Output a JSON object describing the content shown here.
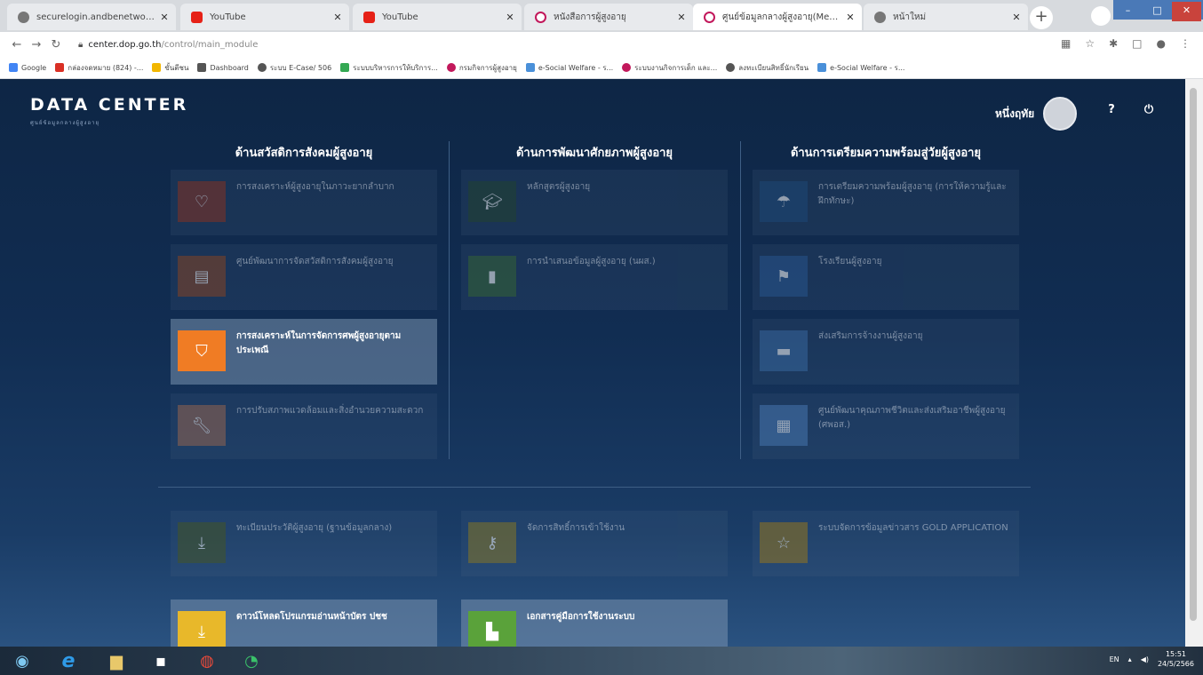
{
  "browser": {
    "tabs": [
      {
        "title": "securelogin.andbenetworks.co",
        "icon": "globe",
        "active": false
      },
      {
        "title": "YouTube",
        "icon": "youtube",
        "active": false
      },
      {
        "title": "YouTube",
        "icon": "youtube",
        "active": false
      },
      {
        "title": "หนังสือการผู้สูงอายุ",
        "icon": "dop-logo",
        "active": false
      },
      {
        "title": "ศูนย์ข้อมูลกลางผู้สูงอายุ(Menu)",
        "icon": "dop-logo",
        "active": true
      },
      {
        "title": "หน้าใหม่",
        "icon": "globe",
        "active": false
      }
    ],
    "url_host": "center.dop.go.th",
    "url_path": "/control/main_module",
    "bookmarks": [
      {
        "label": "Google",
        "color": "#4285f4"
      },
      {
        "label": "กล่องจดหมาย (824) -...",
        "color": "#d93025"
      },
      {
        "label": "ขั้นตีชน",
        "color": "#f2b600"
      },
      {
        "label": "Dashboard",
        "color": "#555555"
      },
      {
        "label": "ระบบ E-Case/ 506",
        "color": "#555555"
      },
      {
        "label": "ระบบบริหารการให้บริการ...",
        "color": "#34a853"
      },
      {
        "label": "กรมกิจการผู้สูงอายุ",
        "color": "#c2185b"
      },
      {
        "label": "e-Social Welfare - ร...",
        "color": "#4a90d9"
      },
      {
        "label": "ระบบงานกิจการเด็ก และ...",
        "color": "#c2185b"
      },
      {
        "label": "ลงทะเบียนสิทธิ์นักเรียน",
        "color": "#555555"
      },
      {
        "label": "e-Social Welfare - ร...",
        "color": "#4a90d9"
      }
    ]
  },
  "header": {
    "brand": "DATA CENTER",
    "brand_sub": "ศูนย์ข้อมูลกลางผู้สูงอายุ",
    "user_name": "หนึ่งฤทัย"
  },
  "columns": [
    {
      "title": "ด้านสวัสดิการสังคมผู้สูงอายุ"
    },
    {
      "title": "ด้านการพัฒนาศักยภาพผู้สูงอายุ"
    },
    {
      "title": "ด้านการเตรียมความพร้อมสู่วัยผู้สูงอายุ"
    }
  ],
  "cards": {
    "welfare": [
      {
        "label": "การสงเคราะห์ผู้สูงอายุในภาวะยากลำบาก",
        "icon": "heart-icon",
        "color": "#8b3a2b"
      },
      {
        "label": "ศูนย์พัฒนาการจัดสวัสดิการสังคมผู้สูงอายุ",
        "icon": "building-icon",
        "color": "#8b4a2b"
      },
      {
        "label": "การสงเคราะห์ในการจัดการศพผู้สูงอายุตามประเพณี",
        "icon": "bookmark-icon",
        "color": "#f07c24"
      },
      {
        "label": "การปรับสภาพแวดล้อมและสิ่งอำนวยความสะดวก",
        "icon": "wrench-icon",
        "color": "#9a6a55"
      }
    ],
    "development": [
      {
        "label": "หลักสูตรผู้สูงอายุ",
        "icon": "graduation-cap-icon",
        "color": "#2a4a38"
      },
      {
        "label": "การนำเสนอข้อมูลผู้สูงอายุ (นผส.)",
        "icon": "book-icon",
        "color": "#3c6a3c"
      }
    ],
    "preparation": [
      {
        "label": "การเตรียมความพร้อมผู้สูงอายุ (การให้ความรู้และฝึกทักษะ)",
        "icon": "umbrella-icon",
        "color": "#25507e"
      },
      {
        "label": "โรงเรียนผู้สูงอายุ",
        "icon": "flag-icon",
        "color": "#2f5c94"
      },
      {
        "label": "ส่งเสริมการจ้างงานผู้สูงอายุ",
        "icon": "briefcase-icon",
        "color": "#3f6ea4"
      },
      {
        "label": "ศูนย์พัฒนาคุณภาพชีวิตและส่งเสริมอาชีพผู้สูงอายุ (ศพอส.)",
        "icon": "building-icon",
        "color": "#4e7cb4"
      }
    ],
    "bottom": [
      {
        "label": "ทะเบียนประวัติผู้สูงอายุ (ฐานข้อมูลกลาง)",
        "icon": "download-icon",
        "color": "#4a5a2a"
      },
      {
        "label": "จัดการสิทธิ์การเข้าใช้งาน",
        "icon": "key-icon",
        "color": "#8a7a2a"
      },
      {
        "label": "ระบบจัดการข้อมูลข่าวสาร GOLD APPLICATION",
        "icon": "star-icon",
        "color": "#9a7a22"
      },
      {
        "label": "ดาวน์โหลดโปรแกรมอ่านหน้าบัตร ปชช",
        "icon": "download-icon",
        "color": "#e8b82a"
      },
      {
        "label": "เอกสารคู่มือการใช้งานระบบ",
        "icon": "document-icon",
        "color": "#5aa23a"
      }
    ]
  },
  "taskbar": {
    "lang": "EN",
    "time": "15:51",
    "date": "24/5/2566"
  }
}
